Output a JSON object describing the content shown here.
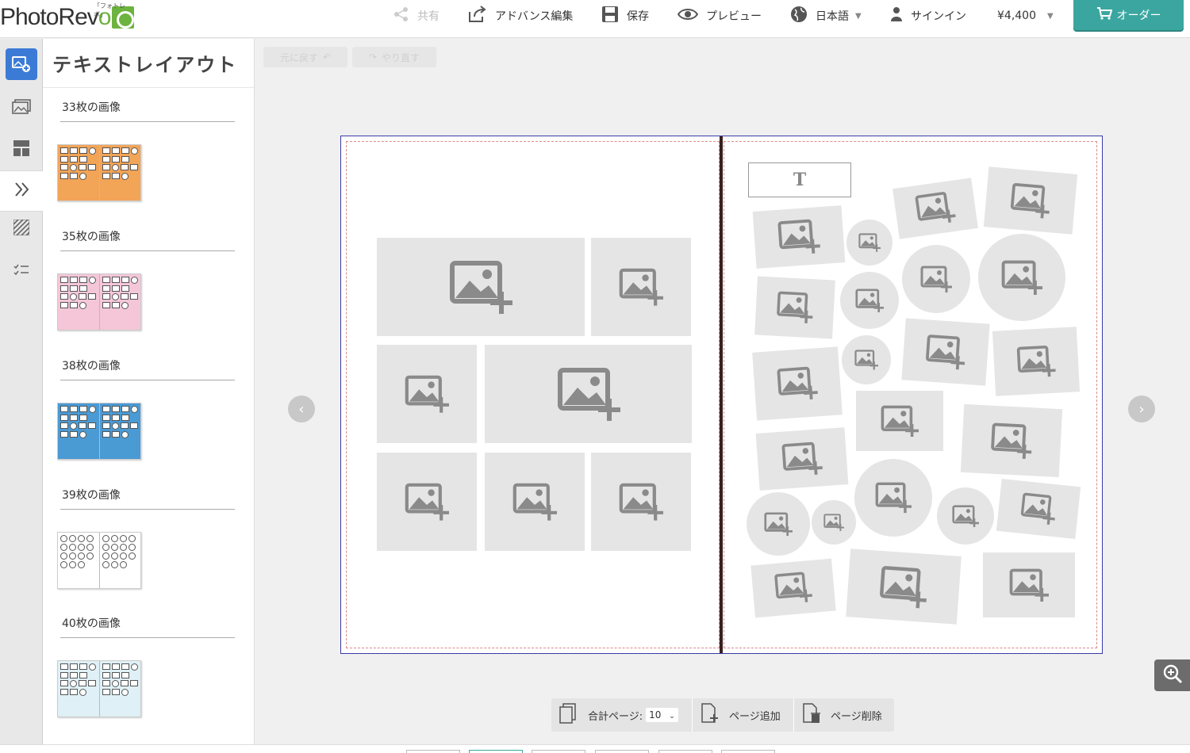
{
  "header": {
    "logo_text": "PhotoRevo",
    "logo_kana": "「フォトレボ」",
    "share_label": "共有",
    "advanced_edit_label": "アドバンス編集",
    "save_label": "保存",
    "preview_label": "プレビュー",
    "language_label": "日本語",
    "signin_label": "サインイン",
    "price_label": "¥4,400",
    "order_label": "オーダー"
  },
  "sidebar": {
    "rail_icons": [
      "add-photo-icon",
      "images-icon",
      "layout-icon",
      "expand-icon",
      "background-pattern-icon",
      "checklist-icon"
    ]
  },
  "panel": {
    "title": "テキストレイアウト",
    "templates": [
      {
        "label": "33枚の画像",
        "theme": "orange"
      },
      {
        "label": "35枚の画像",
        "theme": "pink"
      },
      {
        "label": "38枚の画像",
        "theme": "blue"
      },
      {
        "label": "39枚の画像",
        "theme": "white-circles"
      },
      {
        "label": "40枚の画像",
        "theme": "light-blue"
      }
    ]
  },
  "toolbar": {
    "undo_label": "元に戻す",
    "redo_label": "やり直す"
  },
  "pagebar": {
    "total_pages_label": "合計ページ:",
    "total_pages_value": "10",
    "add_page_label": "ページ追加",
    "delete_page_label": "ページ削除"
  },
  "textbox": {
    "glyph": "T"
  },
  "colors": {
    "accent": "#3ba6a0",
    "active_rail": "#3b7bd6",
    "placeholder": "#e5e5e5",
    "spread_border": "#3a3aa8"
  }
}
